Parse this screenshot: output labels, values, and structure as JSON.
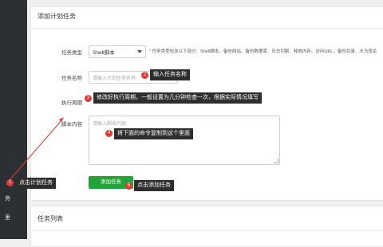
{
  "panel": {
    "title": "添加计划任务",
    "form": {
      "task_type_label": "任务类型",
      "task_type_value": "Shell脚本",
      "task_type_hint_star": "*",
      "task_type_hint": "任务类型包含以下部分：Shell脚本、备份网站、备份数据库、日志切割、释放内存、访问URL、备份目录、木马查杀",
      "task_name_label": "任务名称",
      "task_name_placeholder": "请输入计划任务名称",
      "period_label": "执行周期",
      "script_label": "脚本内容",
      "script_placeholder": "请输入脚本内容",
      "submit_label": "添加任务"
    }
  },
  "panel2": {
    "title": "任务列表"
  },
  "sidebar": {
    "fragments": [
      "务",
      "里"
    ]
  },
  "annotations": [
    {
      "num": "1",
      "text": "点击计划任务"
    },
    {
      "num": "2",
      "text": "输入任务名称"
    },
    {
      "num": "3",
      "text": "修改好执行周期，一般设置为几分钟检查一次，根据实际情况填写"
    },
    {
      "num": "4",
      "text": "将下面的命令复制到这个里面"
    },
    {
      "num": "5",
      "text": "点击添加任务"
    }
  ],
  "colors": {
    "accent": "#20a53a",
    "badge": "#e53935",
    "callout_bg": "#2e2e2e",
    "sidebar_bg": "#2b3035"
  }
}
